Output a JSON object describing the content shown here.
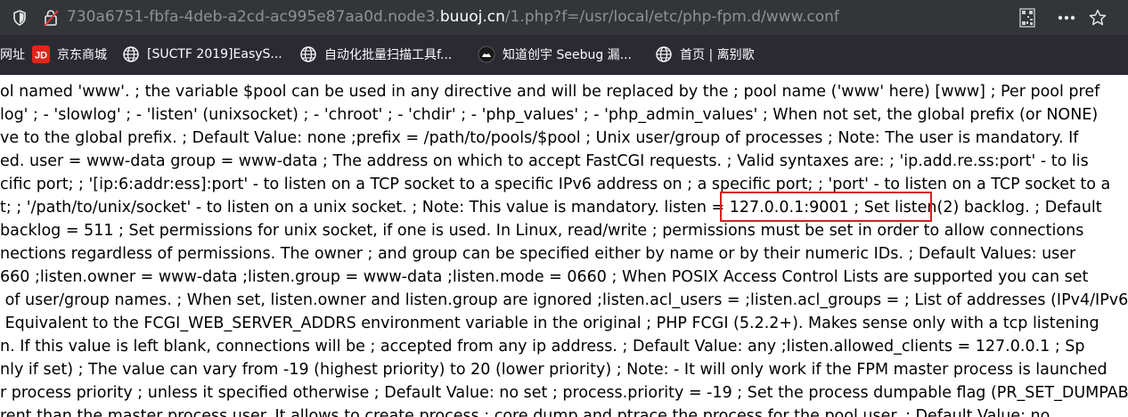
{
  "urlbar": {
    "url_prefix": "730a6751-fbfa-4deb-a2cd-ac995e87aa0d.node3.",
    "url_host": "buuoj.cn",
    "url_path": "/1.php?f=/usr/local/etc/php-fpm.d/www.conf",
    "icons": [
      "shield-icon",
      "insecure-lock-icon",
      "qr-code-icon",
      "more-icon",
      "star-icon"
    ]
  },
  "bookmarks": [
    {
      "label": "网址",
      "icon": "partial-label"
    },
    {
      "label": "京东商城",
      "icon": "jd-logo-icon"
    },
    {
      "label": "[SUCTF 2019]EasyS...",
      "icon": "globe-icon"
    },
    {
      "label": "自动化批量扫描工具f...",
      "icon": "globe-icon"
    },
    {
      "label": "知道创宇 Seebug 漏...",
      "icon": "seebug-icon"
    },
    {
      "label": "首页 | 离别歌",
      "icon": "globe-icon"
    }
  ],
  "content": {
    "lines": [
      "ol named 'www'. ; the variable $pool can be used in any directive and will be replaced by the ; pool name ('www' here) [www] ; Per pool pref",
      "log' ; - 'slowlog' ; - 'listen' (unixsocket) ; - 'chroot' ; - 'chdir' ; - 'php_values' ; - 'php_admin_values' ; When not set, the global prefix (or NONE)",
      "ve to the global prefix. ; Default Value: none ;prefix = /path/to/pools/$pool ; Unix user/group of processes ; Note: The user is mandatory. If",
      "ed. user = www-data group = www-data ; The address on which to accept FastCGI requests. ; Valid syntaxes are: ; 'ip.add.re.ss:port' - to lis",
      "cific port; ; '[ip:6:addr:ess]:port' - to listen on a TCP socket to a specific IPv6 address on ; a specific port; ; 'port' - to listen on a TCP socket to a",
      "t; ; '/path/to/unix/socket' - to listen on a unix socket. ; Note: This value is mandatory. listen = 127.0.0.1:9001 ; Set listen(2) backlog. ; Default",
      "backlog = 511 ; Set permissions for unix socket, if one is used. In Linux, read/write ; permissions must be set in order to allow connections",
      "nections regardless of permissions. The owner ; and group can be specified either by name or by their numeric IDs. ; Default Values: user",
      "660 ;listen.owner = www-data ;listen.group = www-data ;listen.mode = 0660 ; When POSIX Access Control Lists are supported you can set",
      " of user/group names. ; When set, listen.owner and listen.group are ignored ;listen.acl_users = ;listen.acl_groups = ; List of addresses (IPv4/IPv6",
      " Equivalent to the FCGI_WEB_SERVER_ADDRS environment variable in the original ; PHP FCGI (5.2.2+). Makes sense only with a tcp listening",
      "n. If this value is left blank, connections will be ; accepted from any ip address. ; Default Value: any ;listen.allowed_clients = 127.0.0.1 ; Sp",
      "nly if set) ; The value can vary from -19 (highest priority) to 20 (lower priority) ; Note: - It will only work if the FPM master process is launched",
      "r process priority ; unless it specified otherwise ; Default Value: no set ; process.priority = -19 ; Set the process dumpable flag (PR_SET_DUMPAB",
      "rent than the master process user. It allows to create process ; core dump and ptrace the process for the pool user. ; Default Value: no"
    ],
    "highlight_text": "listen = 127.0.0.1:9001 ;",
    "highlight_color": "#d81e1e"
  }
}
